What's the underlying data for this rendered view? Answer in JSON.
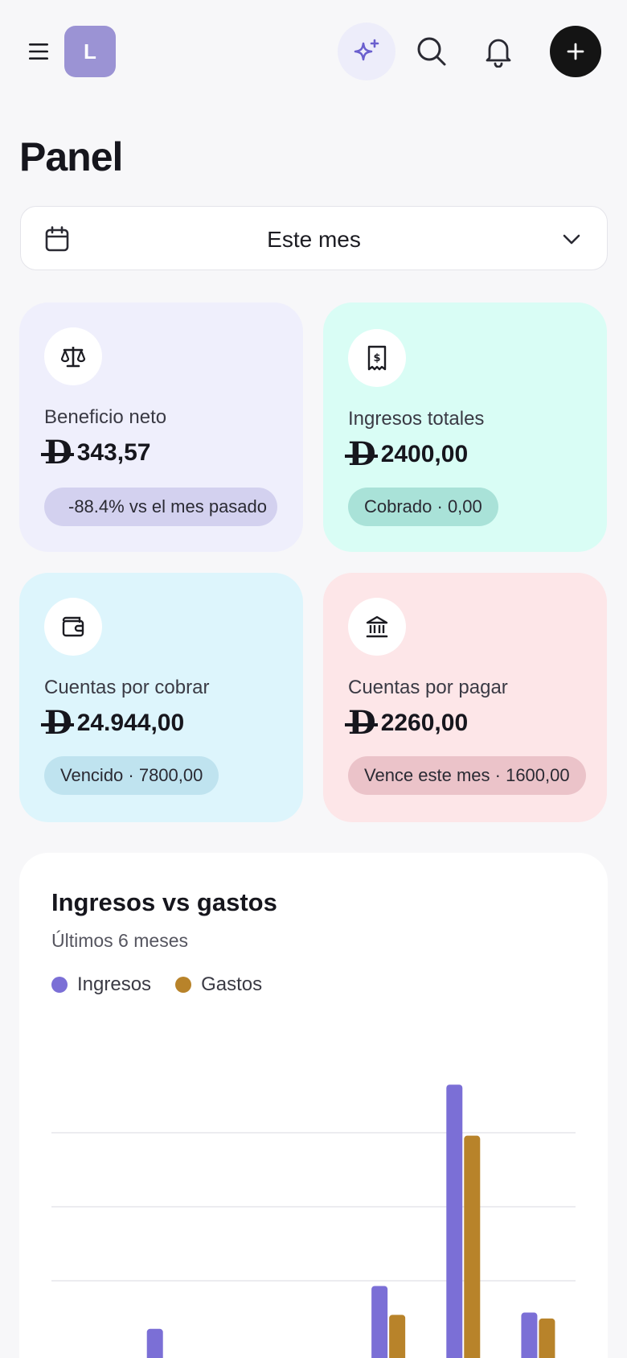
{
  "header": {
    "avatar_initial": "L",
    "icons": [
      "menu-icon",
      "sparkles-icon",
      "search-icon",
      "bell-icon",
      "plus-icon"
    ]
  },
  "page_title": "Panel",
  "period": {
    "label": "Este mes"
  },
  "cards": {
    "net_profit": {
      "title": "Beneficio neto",
      "amount": "343,57",
      "pill": "-88.4% vs el mes pasado"
    },
    "total_income": {
      "title": "Ingresos totales",
      "amount": "2400,00",
      "pill": "Cobrado · 0,00"
    },
    "receivables": {
      "title": "Cuentas por cobrar",
      "amount": "24.944,00",
      "pill": "Vencido · 7800,00"
    },
    "payables": {
      "title": "Cuentas por pagar",
      "amount": "2260,00",
      "pill": "Vence este mes · 1600,00"
    }
  },
  "currency_symbol": "D",
  "income_chart": {
    "title": "Ingresos vs gastos",
    "subtitle": "Últimos 6 meses",
    "legend": {
      "income": "Ingresos",
      "expenses": "Gastos"
    }
  },
  "colors": {
    "income": "#7b6fd6",
    "expenses": "#b8832a"
  },
  "chart_data": {
    "type": "bar",
    "categories": [
      "",
      "",
      "",
      "",
      "",
      ""
    ],
    "series": [
      {
        "name": "Ingresos",
        "values": [
          0,
          0.35,
          0,
          0,
          0.93,
          3.65,
          0.57
        ]
      },
      {
        "name": "Gastos",
        "values": [
          0,
          0,
          0,
          0,
          0.54,
          2.96,
          0.49
        ]
      }
    ],
    "title": "Ingresos vs gastos",
    "subtitle": "Últimos 6 meses",
    "ylim": [
      0,
      4
    ],
    "grid": true,
    "legend": "top-left"
  }
}
